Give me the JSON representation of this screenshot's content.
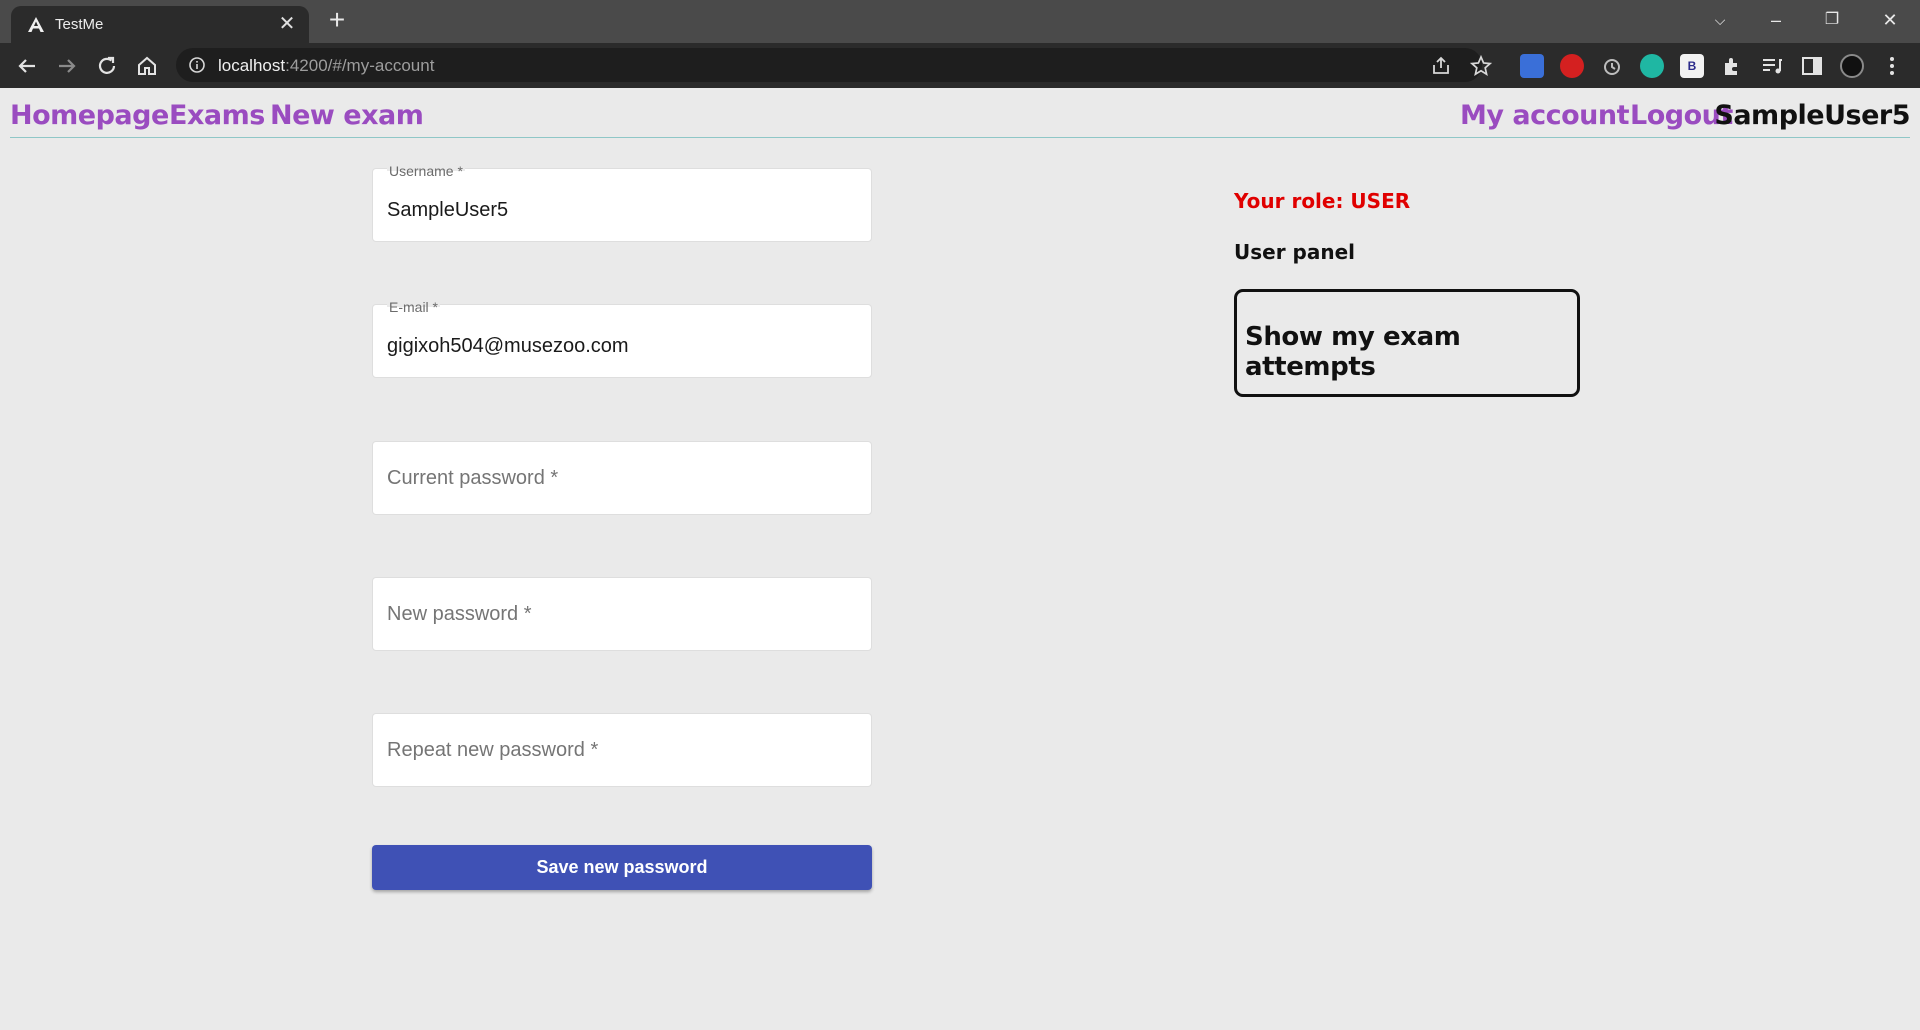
{
  "browser": {
    "tab_title": "TestMe",
    "url_host": "localhost",
    "url_path": ":4200/#/my-account"
  },
  "nav": {
    "homepage": "Homepage",
    "exams": "Exams",
    "new_exam": "New exam",
    "my_account": "My account",
    "logout": "Logout",
    "username": "SampleUser5"
  },
  "form": {
    "username": {
      "label": "Username *",
      "value": "SampleUser5"
    },
    "email": {
      "label": "E-mail *",
      "value": "gigixoh504@musezoo.com"
    },
    "current_password": {
      "placeholder": "Current password *"
    },
    "new_password": {
      "placeholder": "New password *"
    },
    "repeat_password": {
      "placeholder": "Repeat new password *"
    },
    "save_label": "Save new password"
  },
  "panel": {
    "role_text": "Your role: USER",
    "title": "User panel",
    "attempts_label": "Show my exam attempts"
  },
  "colors": {
    "nav_link": "#9a4cc0",
    "role": "#e00000",
    "primary_button": "#3f51b5"
  }
}
